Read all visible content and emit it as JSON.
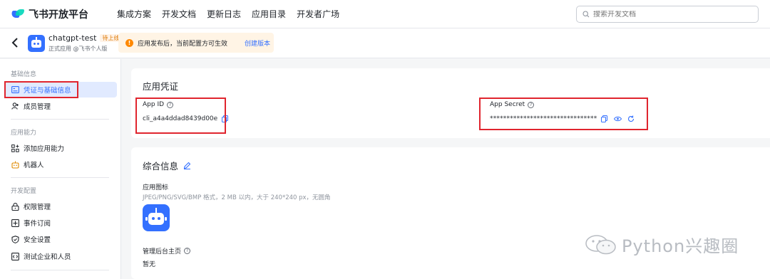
{
  "nav": {
    "brand": "飞书开放平台",
    "items": [
      "集成方案",
      "开发文档",
      "更新日志",
      "应用目录",
      "开发者广场"
    ],
    "search_placeholder": "搜索开发文档"
  },
  "app": {
    "name": "chatgpt-test",
    "badge": "待上线",
    "sub": "正式应用 @飞书个人版",
    "notice": "应用发布后，当前配置方可生效",
    "notice_link": "创建版本"
  },
  "sidebar": {
    "section1": "基础信息",
    "item_credentials": "凭证与基础信息",
    "item_members": "成员管理",
    "section2": "应用能力",
    "item_add_ability": "添加应用能力",
    "item_bot": "机器人",
    "section3": "开发配置",
    "item_permissions": "权限管理",
    "item_events": "事件订阅",
    "item_security": "安全设置",
    "item_test": "测试企业和人员"
  },
  "credentials": {
    "title": "应用凭证",
    "app_id_label": "App ID",
    "app_id_value": "cli_a4a4ddad8439d00e",
    "app_secret_label": "App Secret",
    "app_secret_value": "********************************"
  },
  "general": {
    "title": "综合信息",
    "icon_label": "应用图标",
    "icon_hint": "JPEG/PNG/SVG/BMP 格式，2 MB 以内，大于 240*240 px，无圆角",
    "homepage_label": "管理后台主页",
    "homepage_value": "暂无"
  },
  "watermark": "Python兴趣圈",
  "colors": {
    "accent": "#3370ff",
    "highlight": "#e0252e",
    "notice_bg": "#fff4e5"
  }
}
